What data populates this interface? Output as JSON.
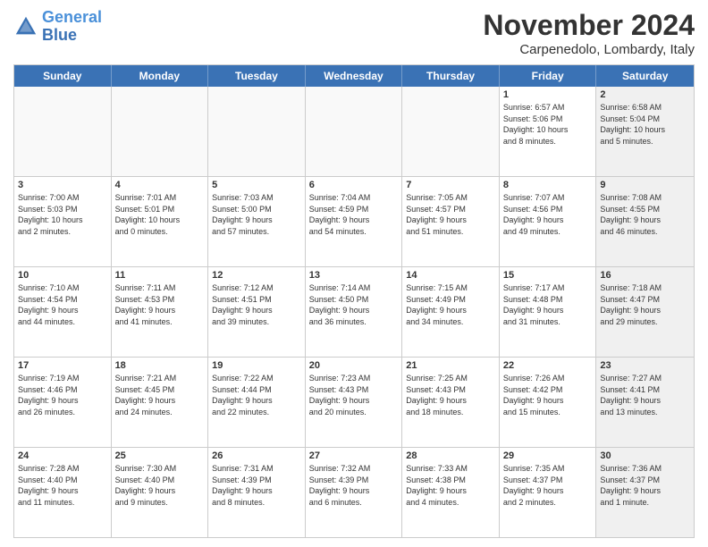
{
  "logo": {
    "line1": "General",
    "line2": "Blue"
  },
  "title": "November 2024",
  "location": "Carpenedolo, Lombardy, Italy",
  "header_days": [
    "Sunday",
    "Monday",
    "Tuesday",
    "Wednesday",
    "Thursday",
    "Friday",
    "Saturday"
  ],
  "weeks": [
    [
      {
        "day": "",
        "info": "",
        "shaded": false,
        "empty": true
      },
      {
        "day": "",
        "info": "",
        "shaded": false,
        "empty": true
      },
      {
        "day": "",
        "info": "",
        "shaded": false,
        "empty": true
      },
      {
        "day": "",
        "info": "",
        "shaded": false,
        "empty": true
      },
      {
        "day": "",
        "info": "",
        "shaded": false,
        "empty": true
      },
      {
        "day": "1",
        "info": "Sunrise: 6:57 AM\nSunset: 5:06 PM\nDaylight: 10 hours\nand 8 minutes.",
        "shaded": false,
        "empty": false
      },
      {
        "day": "2",
        "info": "Sunrise: 6:58 AM\nSunset: 5:04 PM\nDaylight: 10 hours\nand 5 minutes.",
        "shaded": true,
        "empty": false
      }
    ],
    [
      {
        "day": "3",
        "info": "Sunrise: 7:00 AM\nSunset: 5:03 PM\nDaylight: 10 hours\nand 2 minutes.",
        "shaded": false,
        "empty": false
      },
      {
        "day": "4",
        "info": "Sunrise: 7:01 AM\nSunset: 5:01 PM\nDaylight: 10 hours\nand 0 minutes.",
        "shaded": false,
        "empty": false
      },
      {
        "day": "5",
        "info": "Sunrise: 7:03 AM\nSunset: 5:00 PM\nDaylight: 9 hours\nand 57 minutes.",
        "shaded": false,
        "empty": false
      },
      {
        "day": "6",
        "info": "Sunrise: 7:04 AM\nSunset: 4:59 PM\nDaylight: 9 hours\nand 54 minutes.",
        "shaded": false,
        "empty": false
      },
      {
        "day": "7",
        "info": "Sunrise: 7:05 AM\nSunset: 4:57 PM\nDaylight: 9 hours\nand 51 minutes.",
        "shaded": false,
        "empty": false
      },
      {
        "day": "8",
        "info": "Sunrise: 7:07 AM\nSunset: 4:56 PM\nDaylight: 9 hours\nand 49 minutes.",
        "shaded": false,
        "empty": false
      },
      {
        "day": "9",
        "info": "Sunrise: 7:08 AM\nSunset: 4:55 PM\nDaylight: 9 hours\nand 46 minutes.",
        "shaded": true,
        "empty": false
      }
    ],
    [
      {
        "day": "10",
        "info": "Sunrise: 7:10 AM\nSunset: 4:54 PM\nDaylight: 9 hours\nand 44 minutes.",
        "shaded": false,
        "empty": false
      },
      {
        "day": "11",
        "info": "Sunrise: 7:11 AM\nSunset: 4:53 PM\nDaylight: 9 hours\nand 41 minutes.",
        "shaded": false,
        "empty": false
      },
      {
        "day": "12",
        "info": "Sunrise: 7:12 AM\nSunset: 4:51 PM\nDaylight: 9 hours\nand 39 minutes.",
        "shaded": false,
        "empty": false
      },
      {
        "day": "13",
        "info": "Sunrise: 7:14 AM\nSunset: 4:50 PM\nDaylight: 9 hours\nand 36 minutes.",
        "shaded": false,
        "empty": false
      },
      {
        "day": "14",
        "info": "Sunrise: 7:15 AM\nSunset: 4:49 PM\nDaylight: 9 hours\nand 34 minutes.",
        "shaded": false,
        "empty": false
      },
      {
        "day": "15",
        "info": "Sunrise: 7:17 AM\nSunset: 4:48 PM\nDaylight: 9 hours\nand 31 minutes.",
        "shaded": false,
        "empty": false
      },
      {
        "day": "16",
        "info": "Sunrise: 7:18 AM\nSunset: 4:47 PM\nDaylight: 9 hours\nand 29 minutes.",
        "shaded": true,
        "empty": false
      }
    ],
    [
      {
        "day": "17",
        "info": "Sunrise: 7:19 AM\nSunset: 4:46 PM\nDaylight: 9 hours\nand 26 minutes.",
        "shaded": false,
        "empty": false
      },
      {
        "day": "18",
        "info": "Sunrise: 7:21 AM\nSunset: 4:45 PM\nDaylight: 9 hours\nand 24 minutes.",
        "shaded": false,
        "empty": false
      },
      {
        "day": "19",
        "info": "Sunrise: 7:22 AM\nSunset: 4:44 PM\nDaylight: 9 hours\nand 22 minutes.",
        "shaded": false,
        "empty": false
      },
      {
        "day": "20",
        "info": "Sunrise: 7:23 AM\nSunset: 4:43 PM\nDaylight: 9 hours\nand 20 minutes.",
        "shaded": false,
        "empty": false
      },
      {
        "day": "21",
        "info": "Sunrise: 7:25 AM\nSunset: 4:43 PM\nDaylight: 9 hours\nand 18 minutes.",
        "shaded": false,
        "empty": false
      },
      {
        "day": "22",
        "info": "Sunrise: 7:26 AM\nSunset: 4:42 PM\nDaylight: 9 hours\nand 15 minutes.",
        "shaded": false,
        "empty": false
      },
      {
        "day": "23",
        "info": "Sunrise: 7:27 AM\nSunset: 4:41 PM\nDaylight: 9 hours\nand 13 minutes.",
        "shaded": true,
        "empty": false
      }
    ],
    [
      {
        "day": "24",
        "info": "Sunrise: 7:28 AM\nSunset: 4:40 PM\nDaylight: 9 hours\nand 11 minutes.",
        "shaded": false,
        "empty": false
      },
      {
        "day": "25",
        "info": "Sunrise: 7:30 AM\nSunset: 4:40 PM\nDaylight: 9 hours\nand 9 minutes.",
        "shaded": false,
        "empty": false
      },
      {
        "day": "26",
        "info": "Sunrise: 7:31 AM\nSunset: 4:39 PM\nDaylight: 9 hours\nand 8 minutes.",
        "shaded": false,
        "empty": false
      },
      {
        "day": "27",
        "info": "Sunrise: 7:32 AM\nSunset: 4:39 PM\nDaylight: 9 hours\nand 6 minutes.",
        "shaded": false,
        "empty": false
      },
      {
        "day": "28",
        "info": "Sunrise: 7:33 AM\nSunset: 4:38 PM\nDaylight: 9 hours\nand 4 minutes.",
        "shaded": false,
        "empty": false
      },
      {
        "day": "29",
        "info": "Sunrise: 7:35 AM\nSunset: 4:37 PM\nDaylight: 9 hours\nand 2 minutes.",
        "shaded": false,
        "empty": false
      },
      {
        "day": "30",
        "info": "Sunrise: 7:36 AM\nSunset: 4:37 PM\nDaylight: 9 hours\nand 1 minute.",
        "shaded": true,
        "empty": false
      }
    ]
  ]
}
